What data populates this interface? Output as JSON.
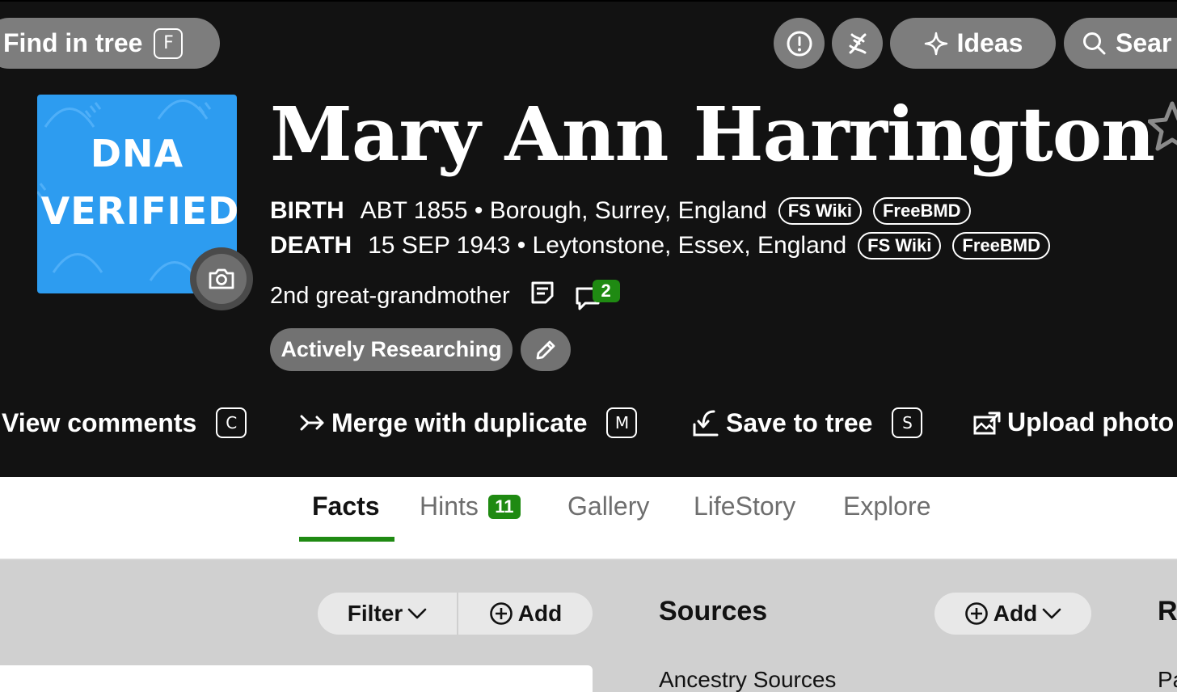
{
  "toolbar": {
    "find_label": "Find in tree",
    "find_key": "F",
    "ideas_label": "Ideas",
    "search_label": "Sear"
  },
  "profile": {
    "dna_line1": "DNA",
    "dna_line2": "VERIFIED",
    "name": "Mary Ann Harrington",
    "birth_label": "BIRTH",
    "birth_value": "ABT 1855 • Borough, Surrey, England",
    "death_label": "DEATH",
    "death_value": "15 SEP 1943 • Leytonstone, Essex, England",
    "chip_fswiki": "FS Wiki",
    "chip_freebmd": "FreeBMD",
    "relation": "2nd great-grandmother",
    "comment_count": "2",
    "status_label": "Actively Researching"
  },
  "actions": [
    {
      "label": "View comments",
      "key": "C"
    },
    {
      "label": "Merge with duplicate",
      "key": "M"
    },
    {
      "label": "Save to tree",
      "key": "S"
    },
    {
      "label": "Upload photo"
    }
  ],
  "tabs": [
    {
      "label": "Facts"
    },
    {
      "label": "Hints",
      "badge": "11"
    },
    {
      "label": "Gallery"
    },
    {
      "label": "LifeStory"
    },
    {
      "label": "Explore"
    }
  ],
  "facts_panel": {
    "filter_label": "Filter",
    "add_label": "Add"
  },
  "sources_panel": {
    "title": "Sources",
    "add_label": "Add",
    "sub_heading": "Ancestry Sources"
  },
  "right_panel": {
    "title_fragment": "R",
    "text_fragment": "Pa"
  },
  "colors": {
    "header_bg": "#121212",
    "accent_green": "#1f8a12",
    "dna_blue": "#2d9cf0",
    "pill_gray": "#7d7d7d"
  }
}
